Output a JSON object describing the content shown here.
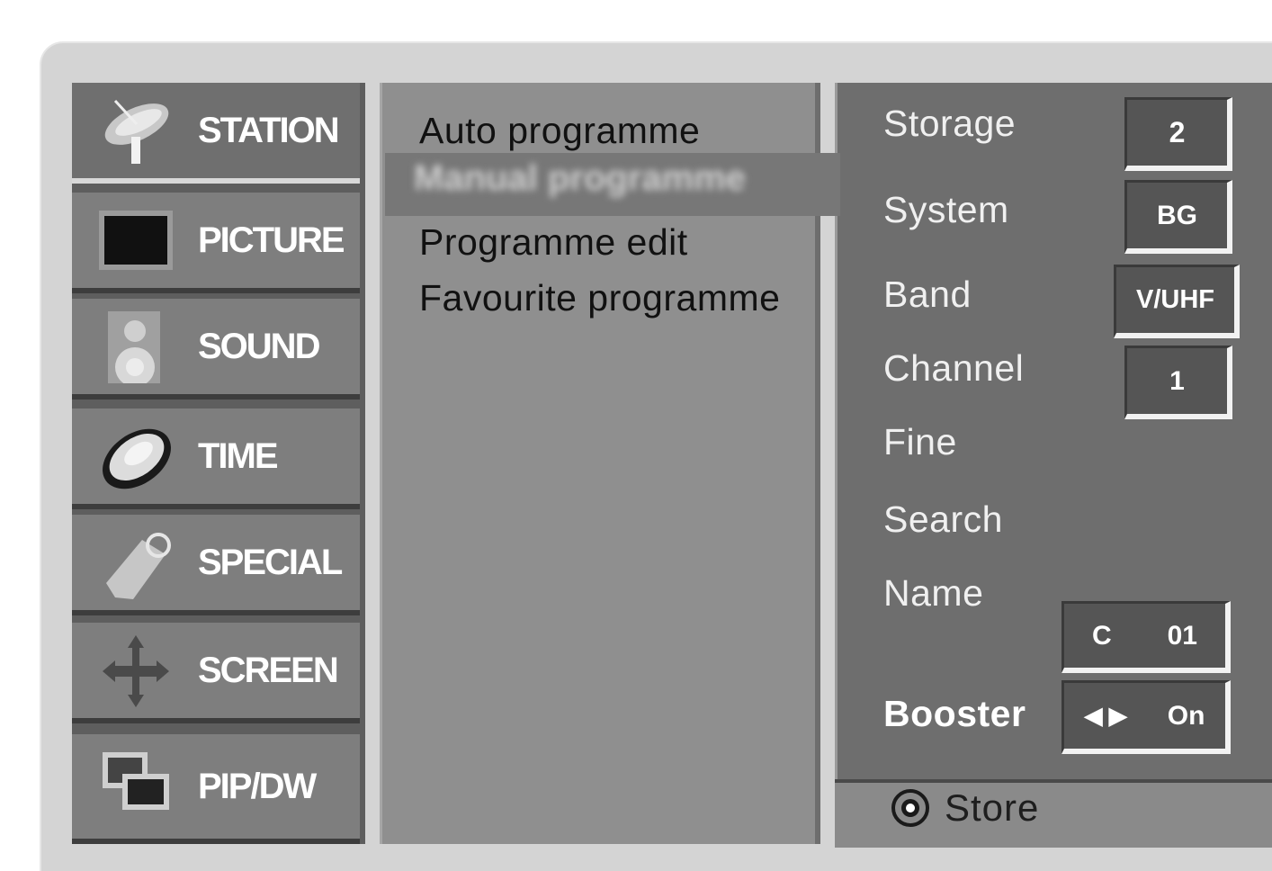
{
  "left_menu": [
    {
      "label": "STATION",
      "icon": "satellite-dish-icon",
      "selected": true
    },
    {
      "label": "PICTURE",
      "icon": "tv-screen-icon"
    },
    {
      "label": "SOUND",
      "icon": "speaker-icon"
    },
    {
      "label": "TIME",
      "icon": "clock-icon"
    },
    {
      "label": "SPECIAL",
      "icon": "tag-icon"
    },
    {
      "label": "SCREEN",
      "icon": "move-arrows-icon"
    },
    {
      "label": "PIP/DW",
      "icon": "pip-windows-icon"
    }
  ],
  "middle_menu": {
    "items": [
      "Auto programme",
      "Programme edit",
      "Favourite programme"
    ],
    "highlighted_blurred": "Manual programme"
  },
  "settings": {
    "storage_label": "Storage",
    "storage_value": "2",
    "system_label": "System",
    "system_value": "BG",
    "band_label": "Band",
    "band_value": "V/UHF",
    "channel_label": "Channel",
    "channel_value": "1",
    "fine_label": "Fine",
    "search_label": "Search",
    "name_label": "Name",
    "name_value_prefix": "C",
    "name_value_number": "01",
    "booster_label": "Booster",
    "booster_arrows": "◀ ▶",
    "booster_value": "On"
  },
  "footer": {
    "store_label": "Store",
    "store_icon": "ok-circle-icon"
  }
}
